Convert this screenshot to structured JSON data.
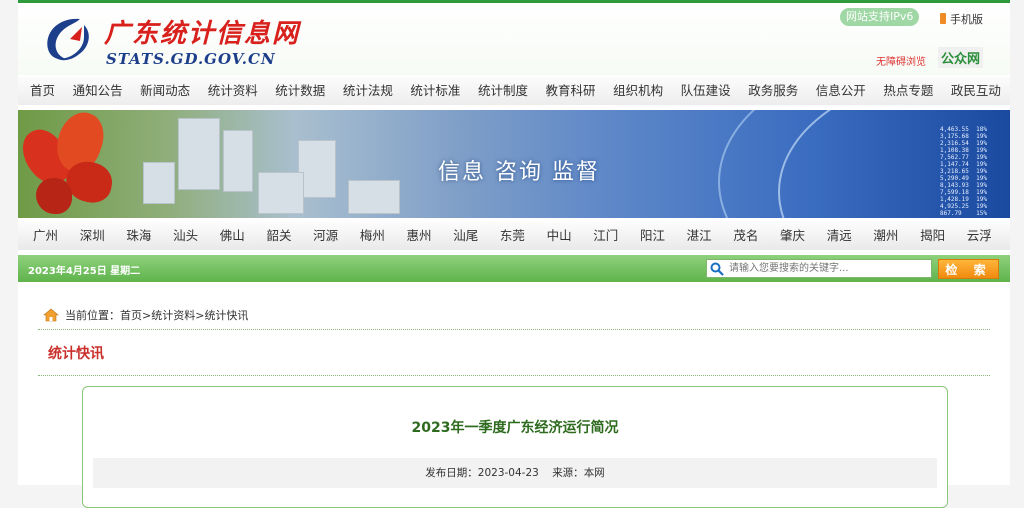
{
  "header": {
    "logo_cn": "广东统计信息网",
    "logo_en": "STATS.GD.GOV.CN",
    "ipv6": "网站支持IPv6",
    "mobile": "手机版",
    "barrier_free": "无障碍浏览",
    "public_account": "公众网"
  },
  "nav": [
    "首页",
    "通知公告",
    "新闻动态",
    "统计资料",
    "统计数据",
    "统计法规",
    "统计标准",
    "统计制度",
    "教育科研",
    "组织机构",
    "队伍建设",
    "政务服务",
    "信息公开",
    "热点专题",
    "政民互动"
  ],
  "banner": {
    "slogan": "信息 咨询 监督"
  },
  "cities": [
    "广州",
    "深圳",
    "珠海",
    "汕头",
    "佛山",
    "韶关",
    "河源",
    "梅州",
    "惠州",
    "汕尾",
    "东莞",
    "中山",
    "江门",
    "阳江",
    "湛江",
    "茂名",
    "肇庆",
    "清远",
    "潮州",
    "揭阳",
    "云浮"
  ],
  "toolbar": {
    "date": "2023年4月25日 星期二",
    "search_placeholder": "请输入您要搜索的关键字...",
    "search_button": "检 索"
  },
  "breadcrumb": {
    "prefix": "当前位置：",
    "items": [
      "首页",
      "统计资料",
      "统计快讯"
    ],
    "separator": " > "
  },
  "section": {
    "title": "统计快讯"
  },
  "article": {
    "title": "2023年一季度广东经济运行简况",
    "publish_label": "发布日期：",
    "publish_date": "2023-04-23",
    "source_label": "来源：",
    "source": "本网"
  },
  "colors": {
    "brand_green": "#2f9a3c",
    "accent_orange": "#f08a10",
    "title_red": "#c9302c"
  }
}
